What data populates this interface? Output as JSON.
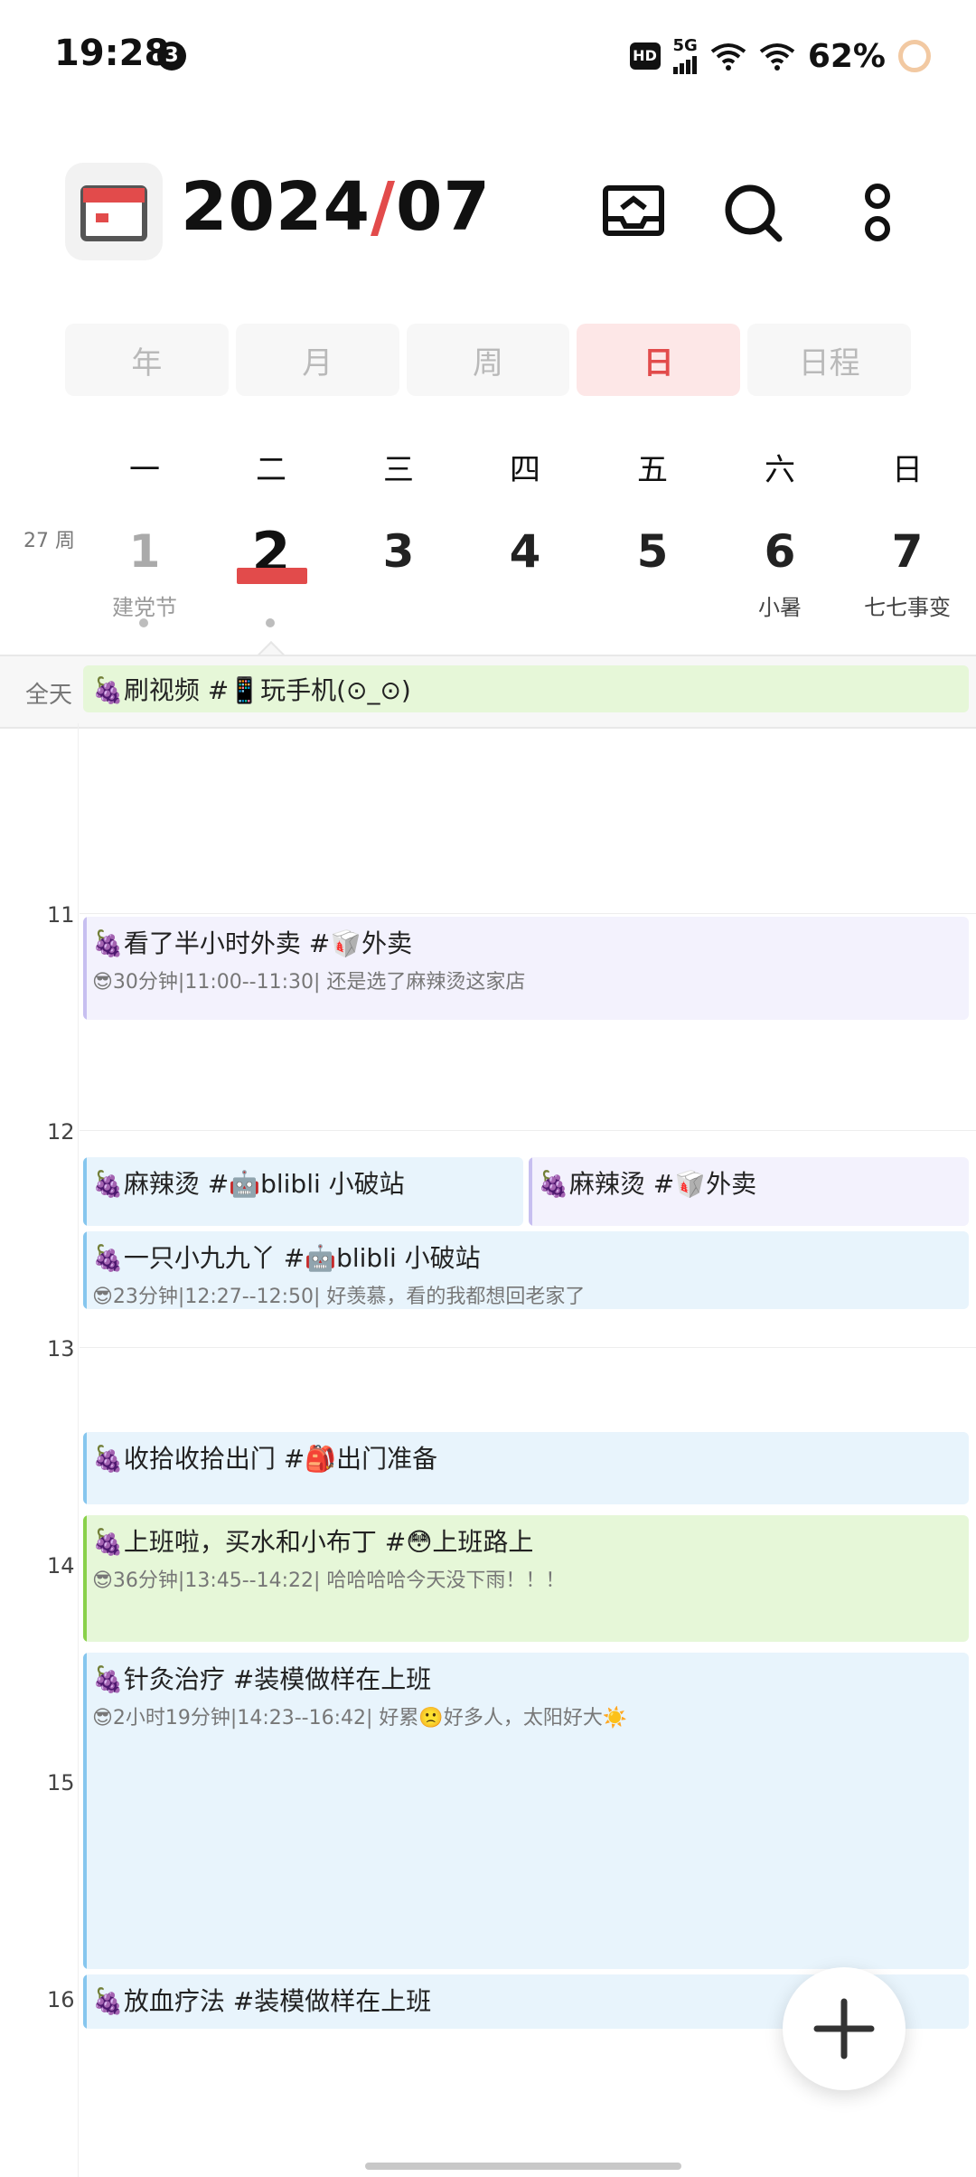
{
  "status": {
    "time": "19:28",
    "notif_count": "3",
    "hd": "HD",
    "network": "5G",
    "battery": "62%"
  },
  "header": {
    "year": "2024",
    "sep": "/",
    "month": "07"
  },
  "views": {
    "year": "年",
    "month": "月",
    "week": "周",
    "day": "日",
    "agenda": "日程"
  },
  "week": {
    "week_label": "27 周",
    "days": [
      {
        "dow": "一",
        "date": "1",
        "sub": "建党节"
      },
      {
        "dow": "二",
        "date": "2",
        "sub": ""
      },
      {
        "dow": "三",
        "date": "3",
        "sub": ""
      },
      {
        "dow": "四",
        "date": "4",
        "sub": ""
      },
      {
        "dow": "五",
        "date": "5",
        "sub": ""
      },
      {
        "dow": "六",
        "date": "6",
        "sub": "小暑"
      },
      {
        "dow": "日",
        "date": "7",
        "sub": "七七事变"
      }
    ]
  },
  "allday": {
    "label": "全天",
    "event": "🍇刷视频 #📱玩手机(⊙_⊙)"
  },
  "hours": [
    "11",
    "12",
    "13",
    "14",
    "15",
    "16"
  ],
  "events": [
    {
      "title": "🍇看了半小时外卖 #🥡外卖",
      "sub": "😎30分钟|11:00--11:30| 还是选了麻辣烫这家店",
      "color": "#f3f2fd",
      "bar": "#c7bff0"
    },
    {
      "title": "🍇麻辣烫 #🤖blibli 小破站",
      "sub": "",
      "color": "#e8f4fc",
      "bar": "#86c6ee"
    },
    {
      "title": "🍇麻辣烫 #🥡外卖",
      "sub": "",
      "color": "#f3f2fd",
      "bar": "#c7bff0"
    },
    {
      "title": "🍇一只小九九丫 #🤖blibli 小破站",
      "sub": "😎23分钟|12:27--12:50| 好羡慕，看的我都想回老家了",
      "color": "#e8f4fc",
      "bar": "#86c6ee"
    },
    {
      "title": "🍇收拾收拾出门 #🎒出门准备",
      "sub": "",
      "color": "#e8f4fc",
      "bar": "#86c6ee"
    },
    {
      "title": "🍇上班啦，买水和小布丁 #😳上班路上",
      "sub": "😎36分钟|13:45--14:22| 哈哈哈哈今天没下雨！！！",
      "color": "#e6f7d8",
      "bar": "#8ad14a"
    },
    {
      "title": "🍇针灸治疗 #装模做样在上班",
      "sub": "😎2小时19分钟|14:23--16:42| 好累🙁好多人，太阳好大☀️",
      "color": "#e8f4fc",
      "bar": "#86c6ee"
    },
    {
      "title": "🍇放血疗法 #装模做样在上班",
      "sub": "",
      "color": "#e8f4fc",
      "bar": "#86c6ee"
    }
  ]
}
